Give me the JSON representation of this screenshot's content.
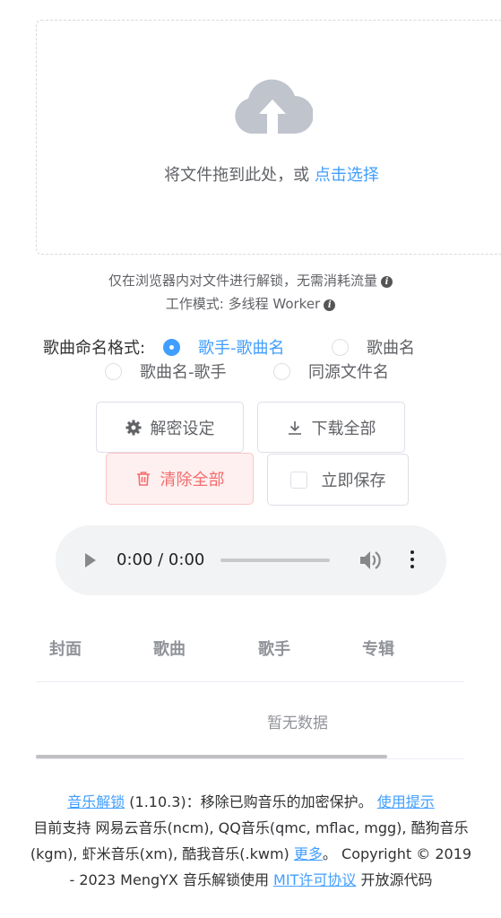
{
  "upload": {
    "prompt": "将文件拖到此处，或",
    "link": "点击选择"
  },
  "notes": {
    "local_only": "仅在浏览器内对文件进行解锁，无需消耗流量",
    "work_mode": "工作模式: 多线程 Worker"
  },
  "naming": {
    "label": "歌曲命名格式:",
    "options": [
      {
        "label": "歌手-歌曲名",
        "checked": true
      },
      {
        "label": "歌曲名",
        "checked": false
      },
      {
        "label": "歌曲名-歌手",
        "checked": false
      },
      {
        "label": "同源文件名",
        "checked": false
      }
    ]
  },
  "buttons": {
    "decrypt_settings": "解密设定",
    "download_all": "下载全部",
    "clear_all": "清除全部",
    "save_now": "立即保存"
  },
  "player": {
    "time": "0:00 / 0:00",
    "progress": 0
  },
  "table": {
    "columns": [
      "封面",
      "歌曲",
      "歌手",
      "专辑"
    ],
    "empty_text": "暂无数据"
  },
  "footer": {
    "app_link": "音乐解锁",
    "version_desc": "(1.10.3)：移除已购音乐的加密保护。",
    "tips_link": "使用提示",
    "support_text": "目前支持 网易云音乐(ncm), QQ音乐(qmc, mflac, mgg), 酷狗音乐(kgm), 虾米音乐(xm), 酷我音乐(.kwm)",
    "more_link": "更多",
    "period": "。",
    "copyright": "Copyright © 2019 - 2023 MengYX 音乐解锁使用",
    "license_link": "MIT许可协议",
    "open_source": "开放源代码"
  },
  "colors": {
    "accent": "#409eff",
    "danger": "#f56c6c",
    "icon_gray": "#c0c4cc"
  }
}
